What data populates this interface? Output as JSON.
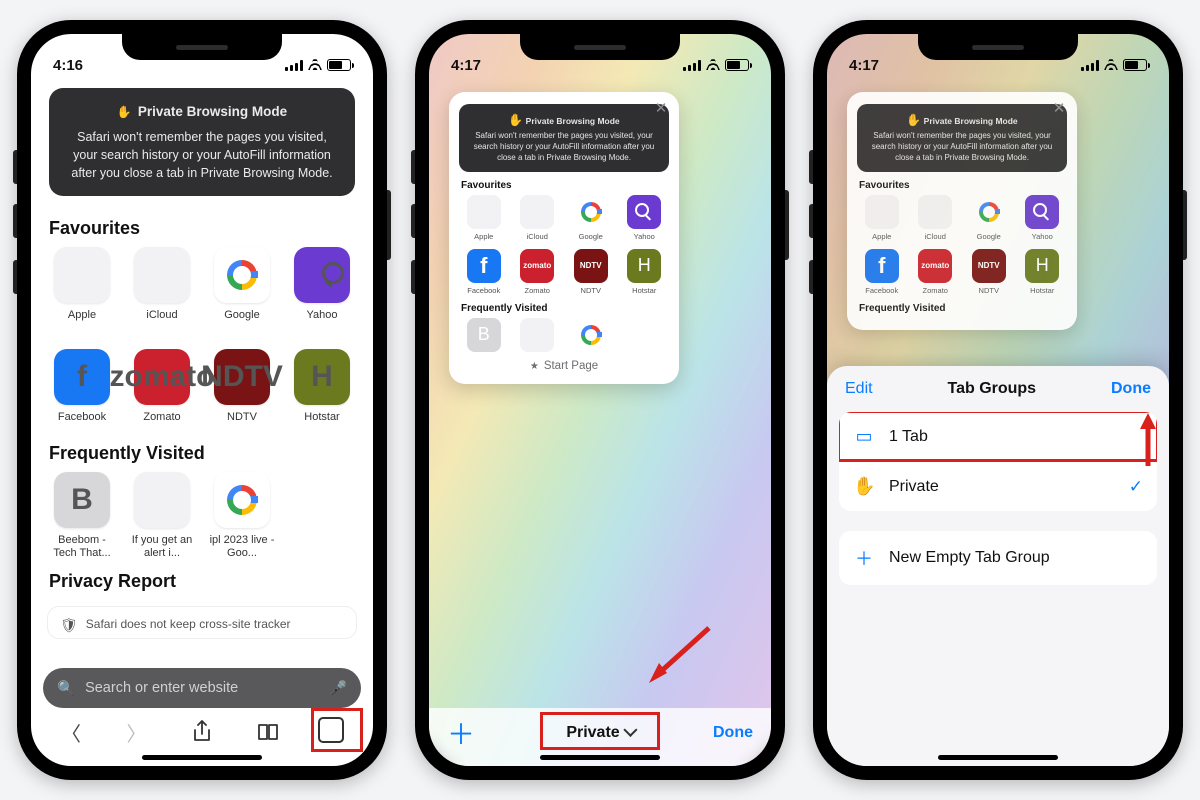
{
  "status": {
    "time1": "4:16",
    "time2": "4:17",
    "time3": "4:17"
  },
  "banner": {
    "title": "Private Browsing Mode",
    "body": "Safari won't remember the pages you visited, your search history or your AutoFill information after you close a tab in Private Browsing Mode."
  },
  "sections": {
    "favourites": "Favourites",
    "frequently": "Frequently Visited",
    "privacy": "Privacy Report"
  },
  "favourites": [
    {
      "label": "Apple",
      "icon": "apple"
    },
    {
      "label": "iCloud",
      "icon": "apple"
    },
    {
      "label": "Google",
      "icon": "google"
    },
    {
      "label": "Yahoo",
      "icon": "yahoo"
    },
    {
      "label": "Facebook",
      "icon": "facebook",
      "glyph": "f"
    },
    {
      "label": "Zomato",
      "icon": "zomato",
      "glyph": "zomato"
    },
    {
      "label": "NDTV",
      "icon": "ndtv",
      "glyph": "NDTV"
    },
    {
      "label": "Hotstar",
      "icon": "hotstar",
      "glyph": "H"
    }
  ],
  "frequently": [
    {
      "label": "Beebom - Tech That...",
      "icon": "grey",
      "glyph": "B"
    },
    {
      "label": "If you get an alert i...",
      "icon": "apple"
    },
    {
      "label": "ipl 2023 live - Goo...",
      "icon": "google"
    }
  ],
  "privacy_line": "Safari does not keep cross-site tracker",
  "search_placeholder": "Search or enter website",
  "tab_card": {
    "label": "Start Page",
    "heading1": "Favourites",
    "heading2": "Frequently Visited"
  },
  "phone2_bottom": {
    "group_label": "Private",
    "done": "Done"
  },
  "sheet": {
    "title": "Tab Groups",
    "edit": "Edit",
    "done": "Done",
    "row1": "1 Tab",
    "row2": "Private",
    "row3": "New Empty Tab Group",
    "plus": "＋"
  },
  "colors": {
    "accent": "#d8201c",
    "ios_blue": "#0a7cff"
  }
}
